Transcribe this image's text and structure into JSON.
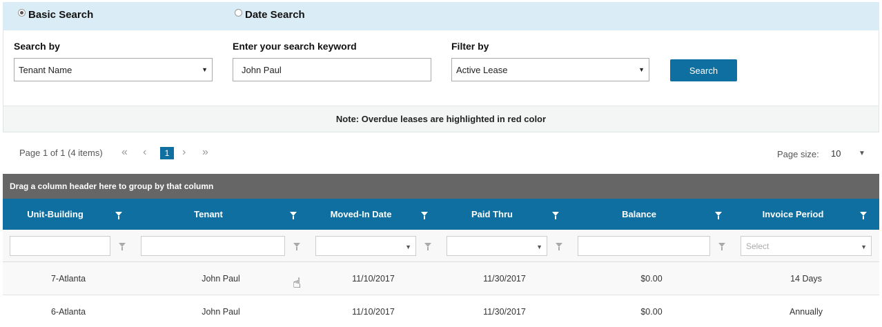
{
  "search_modes": [
    {
      "label": "Basic Search",
      "selected": true
    },
    {
      "label": "Date Search",
      "selected": false
    }
  ],
  "search": {
    "search_by_label": "Search by",
    "search_by_value": "Tenant Name",
    "keyword_label": "Enter your search keyword",
    "keyword_value": "John Paul",
    "filter_label": "Filter by",
    "filter_value": "Active Lease",
    "search_button": "Search"
  },
  "note": "Note: Overdue leases are highlighted in red color",
  "pager": {
    "info": "Page 1 of 1 (4 items)",
    "current_page": "1",
    "page_size_label": "Page size:",
    "page_size_value": "10"
  },
  "group_hint": "Drag a column header here to group by that column",
  "columns": [
    "Unit-Building",
    "Tenant",
    "Moved-In Date",
    "Paid Thru",
    "Balance",
    "Invoice Period"
  ],
  "filters": {
    "invoice_period_placeholder": "Select"
  },
  "rows": [
    [
      "7-Atlanta",
      "John Paul",
      "11/10/2017",
      "11/30/2017",
      "$0.00",
      "14 Days"
    ],
    [
      "6-Atlanta",
      "John Paul",
      "11/10/2017",
      "11/30/2017",
      "$0.00",
      "Annually"
    ]
  ],
  "colors": {
    "accent": "#0e6fa0",
    "mode_bar": "#daecf5",
    "group_bar": "#666666"
  }
}
